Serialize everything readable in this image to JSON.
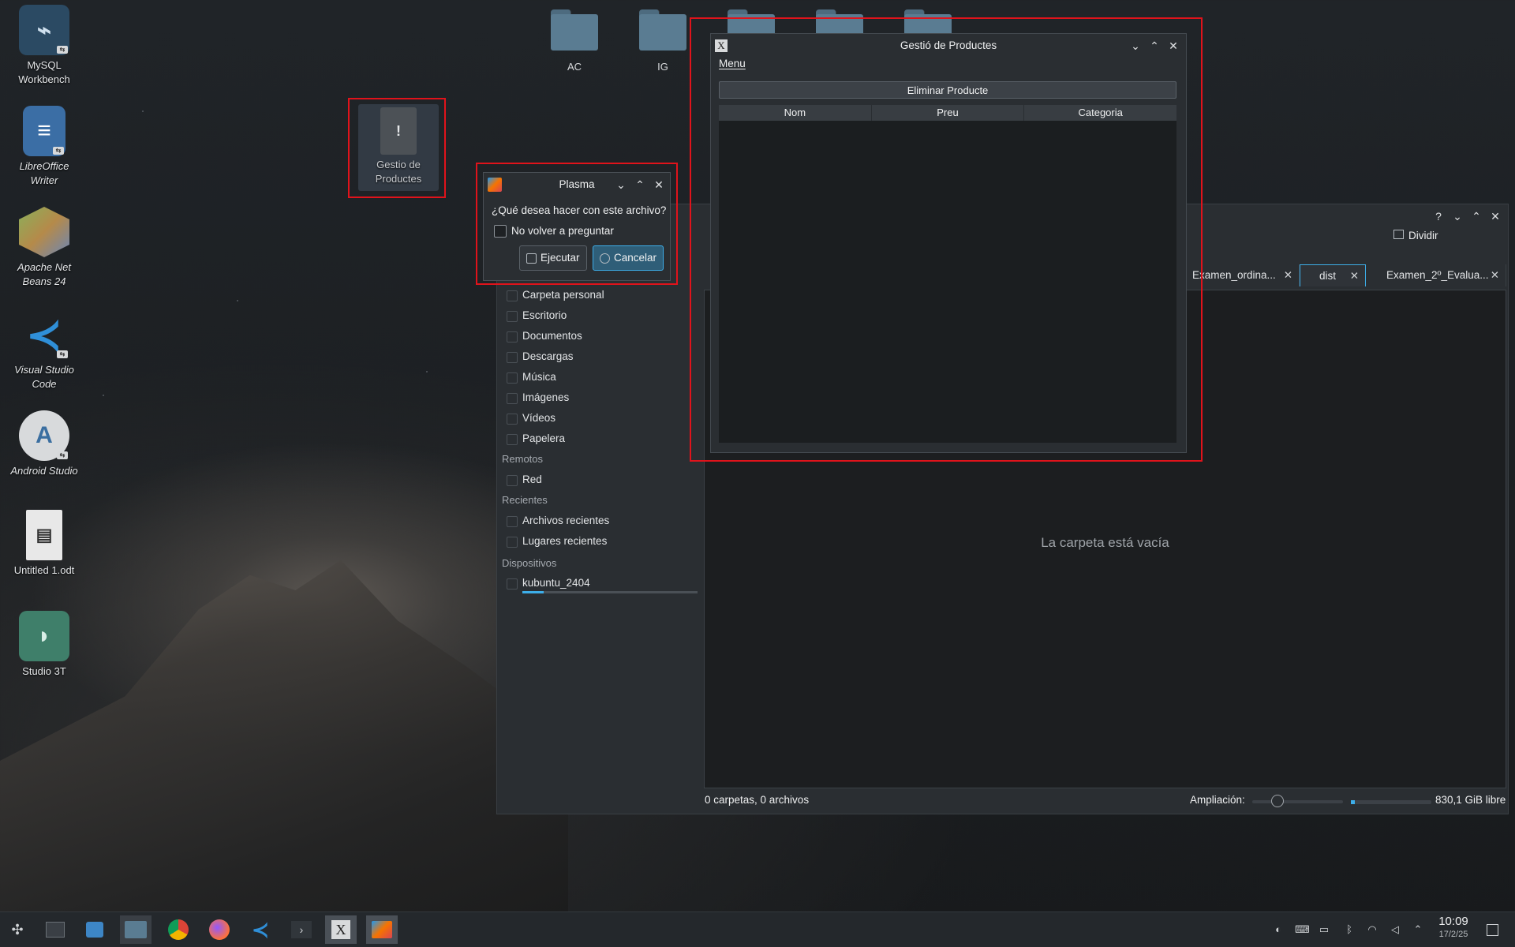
{
  "desktop": {
    "icons": [
      {
        "label": "MySQL Workbench"
      },
      {
        "label": "LibreOffice Writer"
      },
      {
        "label": "Apache Net Beans 24"
      },
      {
        "label": "Visual Studio Code"
      },
      {
        "label": "Android Studio"
      },
      {
        "label": "Untitled 1.odt"
      },
      {
        "label": "Studio 3T"
      },
      {
        "label": "Gestio de Productes"
      }
    ],
    "folders": [
      "AC",
      "IG"
    ]
  },
  "gestio": {
    "title": "Gestió de Productes",
    "menu": "Menu",
    "delete_button": "Eliminar Producte",
    "columns": [
      "Nom",
      "Preu",
      "Categoria"
    ]
  },
  "plasma": {
    "title": "Plasma",
    "question": "¿Qué desea hacer con este archivo?",
    "checkbox_label": "No volver a preguntar",
    "execute": "Ejecutar",
    "cancel": "Cancelar"
  },
  "dolphin": {
    "split_label": "Dividir",
    "tabs": [
      "Examen_ordina...",
      "dist",
      "Examen_2º_Evalua..."
    ],
    "places": [
      "Carpeta personal",
      "Escritorio",
      "Documentos",
      "Descargas",
      "Música",
      "Imágenes",
      "Vídeos",
      "Papelera"
    ],
    "remote_header": "Remotos",
    "remote_items": [
      "Red"
    ],
    "recent_header": "Recientes",
    "recent_items": [
      "Archivos recientes",
      "Lugares recientes"
    ],
    "devices_header": "Dispositivos",
    "devices": [
      "kubuntu_2404"
    ],
    "empty_message": "La carpeta está vacía",
    "status": "0 carpetas, 0 archivos",
    "zoom_label": "Ampliación:",
    "free_space": "830,1 GiB libre"
  },
  "taskbar": {
    "time": "10:09",
    "date": "17/2/25"
  },
  "colors": {
    "accent": "#3daee9",
    "highlight_box": "#e0131b"
  }
}
